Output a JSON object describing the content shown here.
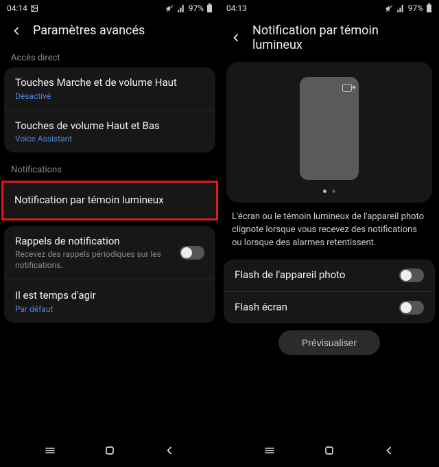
{
  "left": {
    "status": {
      "time": "04:14",
      "battery_pct": "97%"
    },
    "title": "Paramètres avancés",
    "section_direct": "Accès direct",
    "direct": [
      {
        "title": "Touches Marche et de volume Haut",
        "sub": "Désactivé"
      },
      {
        "title": "Touches de volume Haut et Bas",
        "sub": "Voice Assistant"
      }
    ],
    "section_notif": "Notifications",
    "highlighted": "Notification par témoin lumineux",
    "reminder": {
      "title": "Rappels de notification",
      "sub": "Recevez des rappels périodiques sur les notifications."
    },
    "act": {
      "title": "Il est temps d'agir",
      "sub": "Par défaut"
    }
  },
  "right": {
    "status": {
      "time": "04:13",
      "battery_pct": "97%"
    },
    "title": "Notification par témoin lumineux",
    "desc": "L'écran ou le témoin lumineux de l'appareil photo clignote lorsque vous recevez des notifications ou lorsque des alarmes retentissent.",
    "opt_camera": "Flash de l'appareil photo",
    "opt_screen": "Flash écran",
    "preview_btn": "Prévisualiser"
  }
}
